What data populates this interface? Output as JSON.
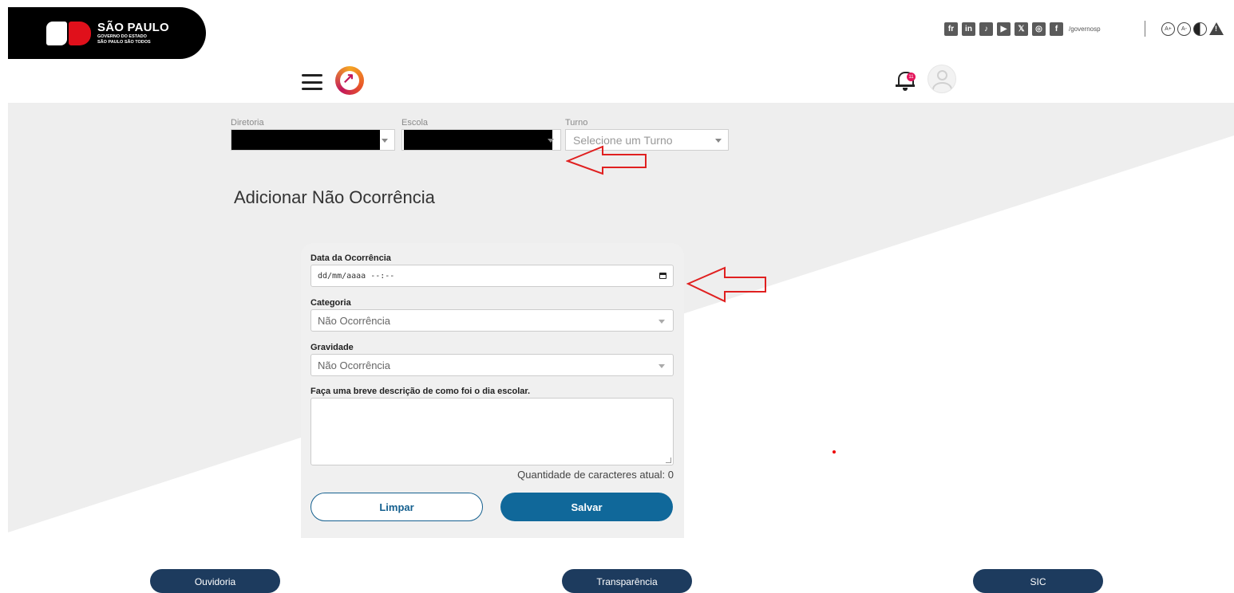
{
  "gov_header": {
    "logo_title": "SÃO PAULO",
    "logo_sub1": "GOVERNO DO ESTADO",
    "logo_sub2": "SÃO PAULO SÃO TODOS",
    "social_icons": [
      "flickr-icon",
      "linkedin-icon",
      "tiktok-icon",
      "youtube-icon",
      "x-icon",
      "instagram-icon",
      "facebook-icon"
    ],
    "social_glyphs": [
      "fr",
      "in",
      "♪",
      "▶",
      "𝕏",
      "◎",
      "f"
    ],
    "social_handle": "/governosp",
    "a11y": {
      "increase_font": "A+",
      "decrease_font": "A-"
    }
  },
  "app_header": {
    "notification_count": "11"
  },
  "filters": {
    "diretoria_label": "Diretoria",
    "escola_label": "Escola",
    "turno_label": "Turno",
    "turno_placeholder": "Selecione um Turno"
  },
  "page_title": "Adicionar Não Ocorrência",
  "form": {
    "date_label": "Data da Ocorrência",
    "date_placeholder": "dd/mm/aaaa --:--",
    "categoria_label": "Categoria",
    "categoria_value": "Não Ocorrência",
    "gravidade_label": "Gravidade",
    "gravidade_value": "Não Ocorrência",
    "descricao_label": "Faça uma breve descrição de como foi o dia escolar.",
    "counter_text": "Quantidade de caracteres atual: 0",
    "clear_button": "Limpar",
    "save_button": "Salvar"
  },
  "footer": {
    "ouvidoria": "Ouvidoria",
    "transparencia": "Transparência",
    "sic": "SIC"
  },
  "colors": {
    "primary_button": "#10689a",
    "footer_button": "#1d3b5e",
    "annotation_red": "#e02020",
    "badge": "#e3165b"
  }
}
